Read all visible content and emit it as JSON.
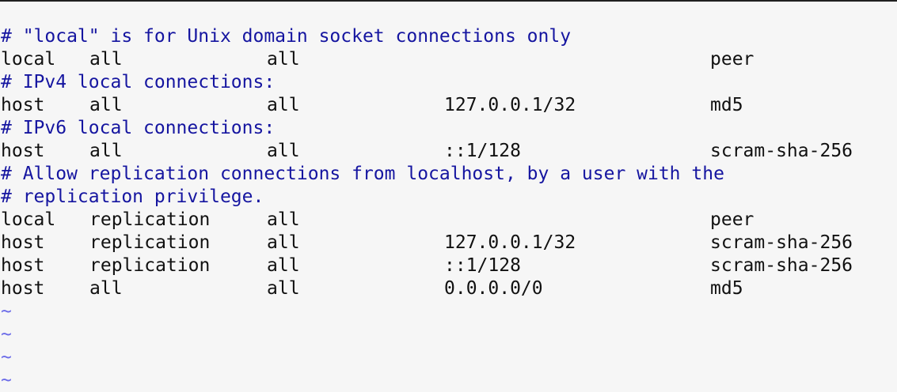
{
  "editor": {
    "comments": {
      "local_sockets": "# \"local\" is for Unix domain socket connections only",
      "ipv4": "# IPv4 local connections:",
      "ipv6": "# IPv6 local connections:",
      "replication_1": "# Allow replication connections from localhost, by a user with the",
      "replication_2": "# replication privilege."
    },
    "rows": [
      {
        "type": "local",
        "database": "all",
        "user": "all",
        "address": "",
        "method": "peer"
      },
      {
        "type": "host",
        "database": "all",
        "user": "all",
        "address": "127.0.0.1/32",
        "method": "md5"
      },
      {
        "type": "host",
        "database": "all",
        "user": "all",
        "address": "::1/128",
        "method": "scram-sha-256"
      },
      {
        "type": "local",
        "database": "replication",
        "user": "all",
        "address": "",
        "method": "peer"
      },
      {
        "type": "host",
        "database": "replication",
        "user": "all",
        "address": "127.0.0.1/32",
        "method": "scram-sha-256"
      },
      {
        "type": "host",
        "database": "replication",
        "user": "all",
        "address": "::1/128",
        "method": "scram-sha-256"
      },
      {
        "type": "host",
        "database": "all",
        "user": "all",
        "address": "0.0.0.0/0",
        "method": "md5"
      }
    ],
    "tilde": "~",
    "colors": {
      "background": "#f6f6f6",
      "comment": "#1515a0",
      "text": "#111111",
      "tilde": "#6a6ae8"
    }
  }
}
